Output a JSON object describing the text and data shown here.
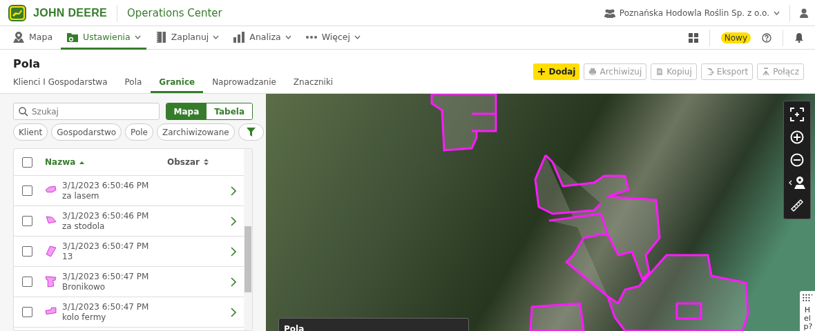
{
  "header": {
    "brand": "JOHN DEERE",
    "app_title": "Operations Center",
    "organization": "Poznańska Hodowla Roślin Sp. z o.o."
  },
  "nav": {
    "items": [
      {
        "label": "Mapa",
        "dropdown": false,
        "selected": false
      },
      {
        "label": "Ustawienia",
        "dropdown": true,
        "selected": true
      },
      {
        "label": "Zaplanuj",
        "dropdown": true,
        "selected": false
      },
      {
        "label": "Analiza",
        "dropdown": true,
        "selected": false
      },
      {
        "label": "Więcej",
        "dropdown": true,
        "selected": false
      }
    ],
    "badge": "Nowy"
  },
  "page": {
    "title": "Pola",
    "tabs": [
      {
        "label": "Klienci I Gospodarstwa",
        "selected": false
      },
      {
        "label": "Pola",
        "selected": false
      },
      {
        "label": "Granice",
        "selected": true
      },
      {
        "label": "Naprowadzanie",
        "selected": false
      },
      {
        "label": "Znaczniki",
        "selected": false
      }
    ],
    "actions": [
      {
        "label": "Dodaj",
        "disabled": false
      },
      {
        "label": "Archiwizuj",
        "disabled": true
      },
      {
        "label": "Kopiuj",
        "disabled": true
      },
      {
        "label": "Eksport",
        "disabled": true
      },
      {
        "label": "Połącz",
        "disabled": true
      }
    ]
  },
  "sidebar": {
    "search": {
      "placeholder": "Szukaj"
    },
    "view_toggle": [
      {
        "label": "Mapa",
        "selected": true
      },
      {
        "label": "Tabela",
        "selected": false
      }
    ],
    "filters": [
      "Klient",
      "Gospodarstwo",
      "Pole",
      "Zarchiwizowane"
    ],
    "table": {
      "select_all_checked": false,
      "columns": [
        {
          "label": "Nazwa",
          "sorted": true
        },
        {
          "label": "Obszar",
          "sorted": false
        }
      ],
      "rows": [
        {
          "timestamp": "3/1/2023 6:50:46 PM",
          "name": "za lasem",
          "checked": false
        },
        {
          "timestamp": "3/1/2023 6:50:46 PM",
          "name": "za stodola",
          "checked": false
        },
        {
          "timestamp": "3/1/2023 6:50:47 PM",
          "name": "13",
          "checked": false
        },
        {
          "timestamp": "3/1/2023 6:50:47 PM",
          "name": "Bronikowo",
          "checked": false
        },
        {
          "timestamp": "3/1/2023 6:50:47 PM",
          "name": "kolo fermy",
          "checked": false
        }
      ]
    }
  },
  "map": {
    "panel_title": "Pola",
    "help": "Help?"
  }
}
